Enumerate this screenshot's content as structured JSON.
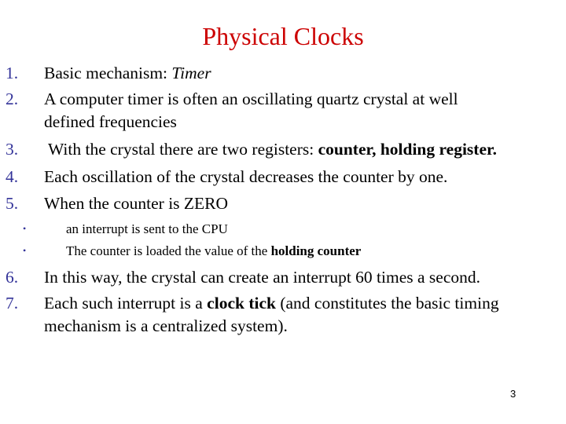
{
  "slide": {
    "title": "Physical Clocks",
    "title_color": "#cc0000",
    "number_color": "#333399",
    "page_number": "3",
    "items": [
      {
        "number": "1.",
        "parts": [
          {
            "text": "Basic mechanism: ",
            "style": "normal"
          },
          {
            "text": "Timer",
            "style": "italic"
          }
        ]
      },
      {
        "number": "2.",
        "line1": "A computer timer is often an oscillating quartz crystal at well",
        "line2": "defined frequencies"
      },
      {
        "number": "3.",
        "parts": [
          {
            "text": " With the crystal there are two registers: ",
            "style": "normal"
          },
          {
            "text": "counter, holding register.",
            "style": "bold"
          }
        ]
      },
      {
        "number": "4.",
        "text": "Each oscillation of the crystal decreases the counter by one."
      },
      {
        "number": "5.",
        "text": "When the counter is ZERO",
        "subitems": [
          {
            "bullet": "•",
            "parts": [
              {
                "text": "an interrupt is sent to the CPU",
                "style": "normal"
              }
            ]
          },
          {
            "bullet": "•",
            "parts": [
              {
                "text": "The counter is loaded the value of the ",
                "style": "normal"
              },
              {
                "text": "holding counter",
                "style": "bold"
              }
            ]
          }
        ]
      },
      {
        "number": "6.",
        "text": "In this way, the crystal can create an interrupt 60 times a second."
      },
      {
        "number": "7.",
        "parts": [
          {
            "text": "Each such interrupt is a ",
            "style": "normal"
          },
          {
            "text": "clock tick",
            "style": "bold"
          },
          {
            "text": " (and constitutes the basic timing",
            "style": "normal"
          }
        ],
        "line2": "mechanism is a centralized system)."
      }
    ]
  }
}
